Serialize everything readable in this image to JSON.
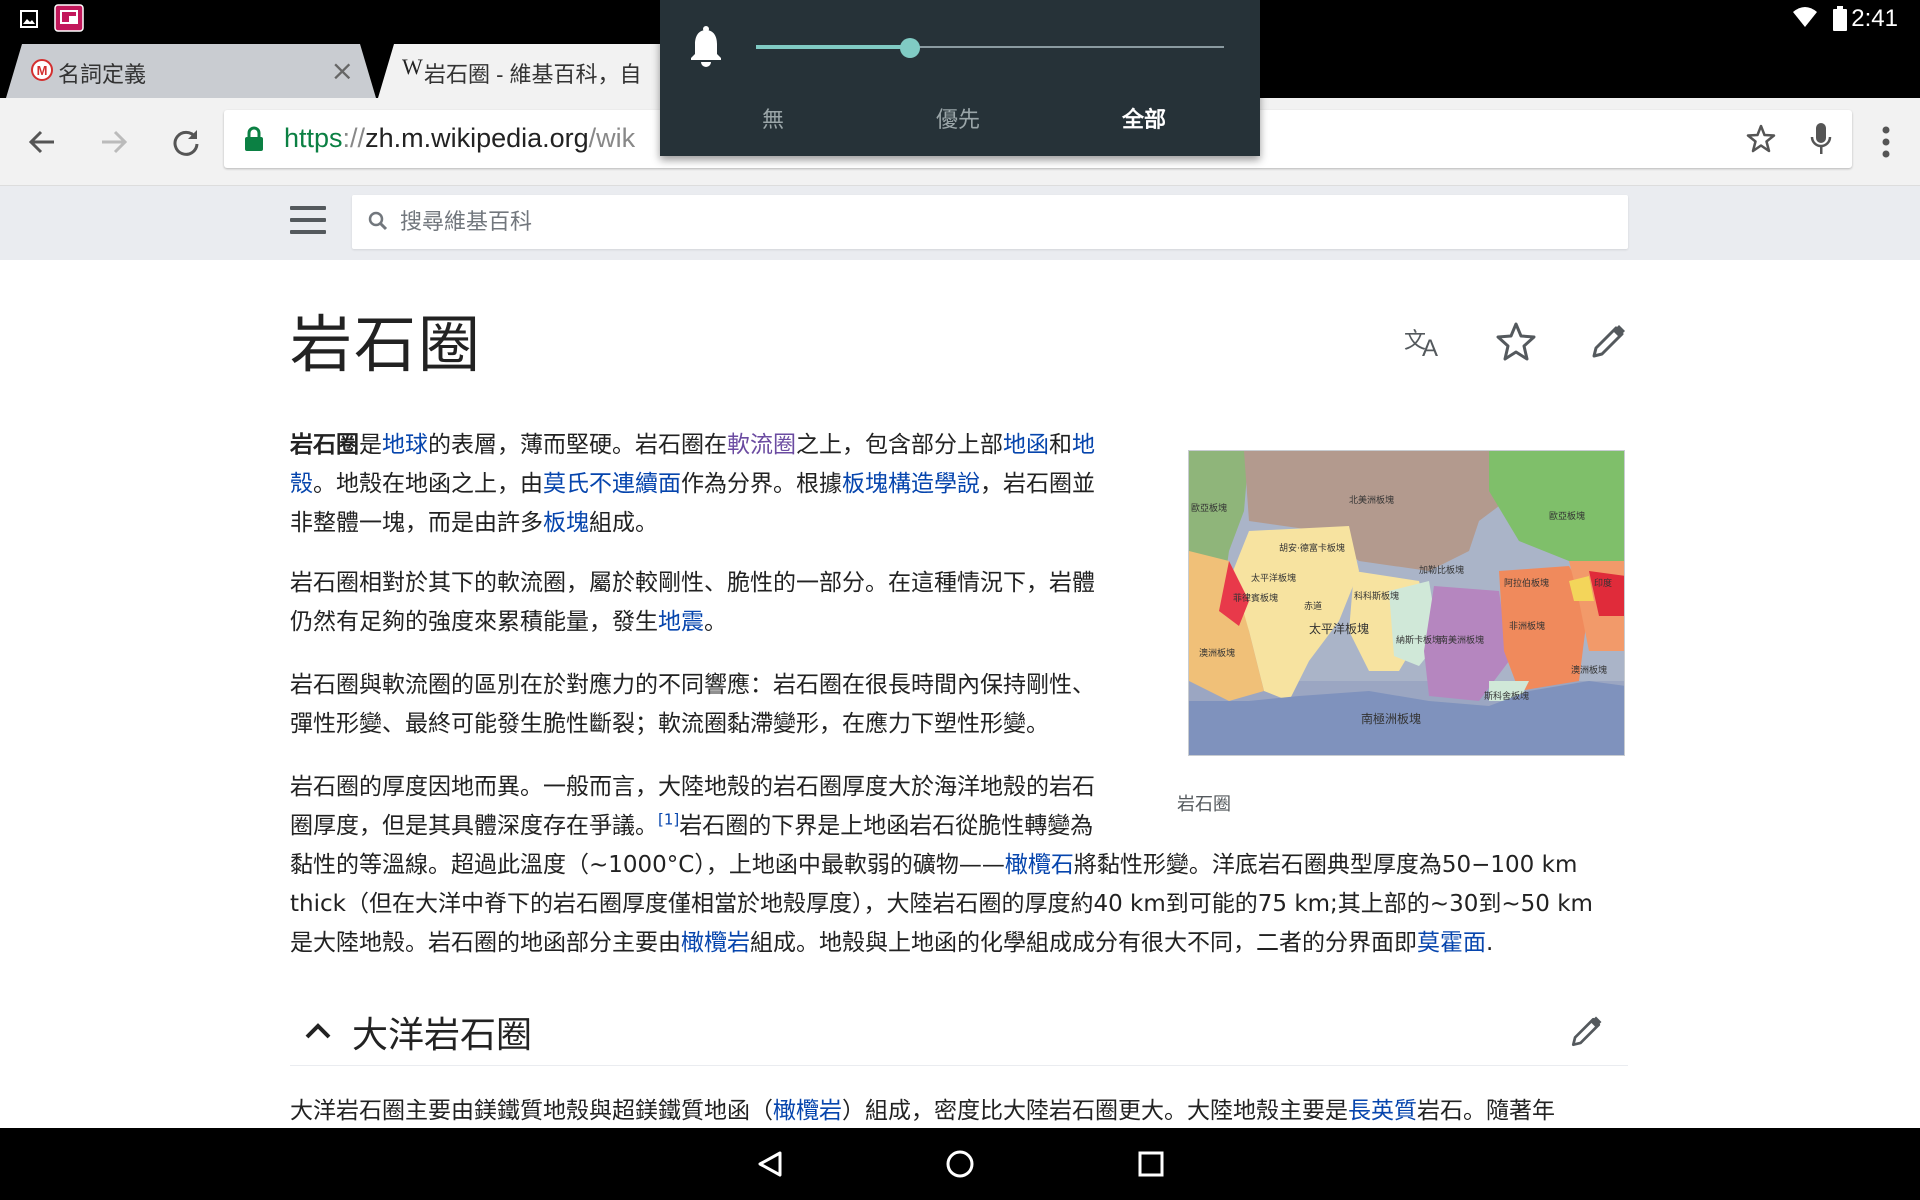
{
  "status_bar": {
    "time": "2:41"
  },
  "tabs": [
    {
      "label": "名詞定義",
      "favicon": "red-logo-icon"
    },
    {
      "label": "岩石圈 - 維基百科，自",
      "favicon": "wikipedia-w-icon"
    }
  ],
  "toolbar": {
    "url_scheme": "https",
    "url_sep": "://",
    "url_host": "zh.m.wikipedia.org",
    "url_path": "/wik"
  },
  "volume_panel": {
    "level_fraction": 0.33,
    "options": [
      "無",
      "優先",
      "全部"
    ],
    "selected": "全部"
  },
  "wiki_header": {
    "search_placeholder": "搜尋維基百科"
  },
  "article": {
    "title": "岩石圈",
    "figure_caption": "岩石圈",
    "map_labels": {
      "north_american": "北美洲板塊",
      "eurasian": "歐亞板塊",
      "eurasian_left": "歐亞板塊",
      "juan_de_fuca": "胡安·德富卡板塊",
      "caribbean": "加勒比板塊",
      "arabian": "阿拉伯板塊",
      "indian": "印度",
      "pacific_left": "太平洋板塊",
      "philippine": "菲律賓板塊",
      "equator": "赤道",
      "cocos": "科科斯板塊",
      "pacific": "太平洋板塊",
      "nazca": "納斯卡板塊",
      "south_american": "南美洲板塊",
      "african": "非洲板塊",
      "australian_left": "澳洲板塊",
      "australian": "澳洲板塊",
      "scotia": "斯科舍板塊",
      "antarctic": "南極洲板塊"
    },
    "p1": {
      "t1": "岩石圈",
      "t2": "是",
      "l1": "地球",
      "t3": "的表層，薄而堅硬。岩石圈在",
      "l2": "軟流圈",
      "t4": "之上，包含部分上部",
      "l3": "地函",
      "t5": "和",
      "l4": "地",
      "l4b": "殼",
      "t6": "。地殼在地函之上，由",
      "l5": "莫氏不連續面",
      "t7": "作為分界。根據",
      "l6": "板塊構造學說",
      "t8": "，岩石圈並",
      "t9": "非整體一塊，而是由許多",
      "l7": "板塊",
      "t10": "組成。"
    },
    "p2": {
      "t1": "岩石圈相對於其下的軟流圈，屬於較剛性、脆性的一部分。在這種情況下，岩體",
      "t2": "仍然有足夠的強度來累積能量，發生",
      "l1": "地震",
      "t3": "。"
    },
    "p3": {
      "t1": "岩石圈與軟流圈的區別在於對應力的不同響應：岩石圈在很長時間內保持剛性、",
      "t2": "彈性形變、最終可能發生脆性斷裂；軟流圈黏滯變形，在應力下塑性形變。"
    },
    "p4": {
      "t1": "岩石圈的厚度因地而異。一般而言，大陸地殼的岩石圈厚度大於海洋地殼的岩石",
      "t2": "圈厚度，但是其具體深度存在爭議。",
      "ref": "[1]",
      "t3": "岩石圈的下界是上地函岩石從脆性轉變為",
      "t4": "黏性的等溫線。超過此溫度（~1000°C），上地函中最軟弱的礦物——",
      "l1": "橄欖石",
      "t5": "將黏性形變。洋底岩石圈典型厚度為50−100 km",
      "t6": "thick（但在大洋中脊下的岩石圈厚度僅相當於地殼厚度），大陸岩石圈的厚度約40 km到可能的75 km;其上部的~30到~50 km",
      "t7": "是大陸地殼。岩石圈的地函部分主要由",
      "l2": "橄欖岩",
      "t8": "組成。地殼與上地函的化學組成成分有很大不同，二者的分界面即",
      "l3": "莫霍面",
      "t9": "."
    },
    "section1": {
      "title": "大洋岩石圈",
      "t1": "大洋岩石圈主要由鎂鐵質地殼與超鎂鐵質地函（",
      "l1": "橄欖岩",
      "t2": "）組成，密度比大陸岩石圈更大。大陸地殼主要是",
      "l2": "長英質",
      "t3": "岩石。隨著年"
    }
  },
  "colors": {
    "link": "#0645ad",
    "visited_link": "#6b4ba1",
    "secure_green": "#0b8043",
    "slider_teal": "#80cbc4",
    "panel_bg": "#263238"
  }
}
